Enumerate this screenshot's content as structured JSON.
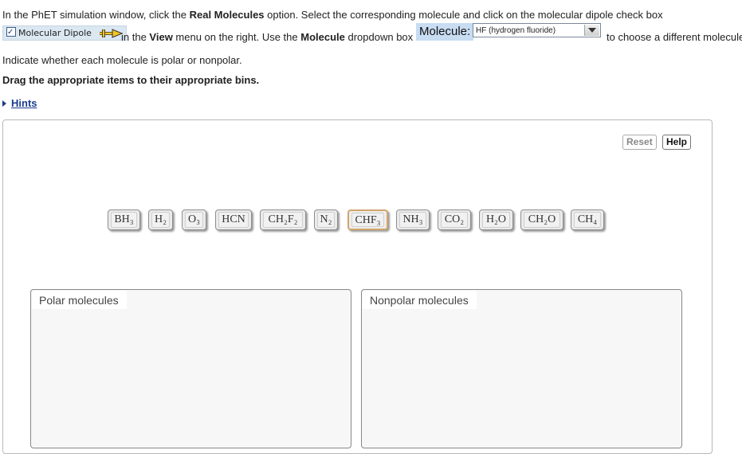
{
  "instructions": {
    "line1_pre": "In the PhET simulation window, click the ",
    "line1_bold": "Real Molecules",
    "line1_post": " option. Select the corresponding molecule and click on the molecular dipole check box",
    "dipole_chip_label": "Molecular Dipole",
    "line2_pre": " in the ",
    "line2_bold1": "View",
    "line2_mid": " menu on the right. Use the ",
    "line2_bold2": "Molecule",
    "line2_post": " dropdown box",
    "molecule_label": "Molecule:",
    "molecule_selected": "HF (hydrogen fluoride)",
    "line2_end": "to choose a different molecule",
    "indicate": "Indicate whether each molecule is polar or nonpolar.",
    "drag": "Drag the appropriate items to their appropriate bins."
  },
  "hints": {
    "label": "Hints"
  },
  "buttons": {
    "reset": "Reset",
    "help": "Help"
  },
  "items": [
    {
      "label": "BH₃"
    },
    {
      "label": "H₂"
    },
    {
      "label": "O₃"
    },
    {
      "label": "HCN"
    },
    {
      "label": "CH₂F₂"
    },
    {
      "label": "N₂"
    },
    {
      "label": "CHF₃",
      "selected": true
    },
    {
      "label": "NH₃"
    },
    {
      "label": "CO₂"
    },
    {
      "label": "H₂O"
    },
    {
      "label": "CH₂O"
    },
    {
      "label": "CH₄"
    }
  ],
  "bins": {
    "polar": "Polar molecules",
    "nonpolar": "Nonpolar molecules"
  },
  "colors": {
    "link": "#1a3c8c",
    "selected_border": "#d1a56a",
    "molecule_label_bg": "#c8dcf2"
  }
}
